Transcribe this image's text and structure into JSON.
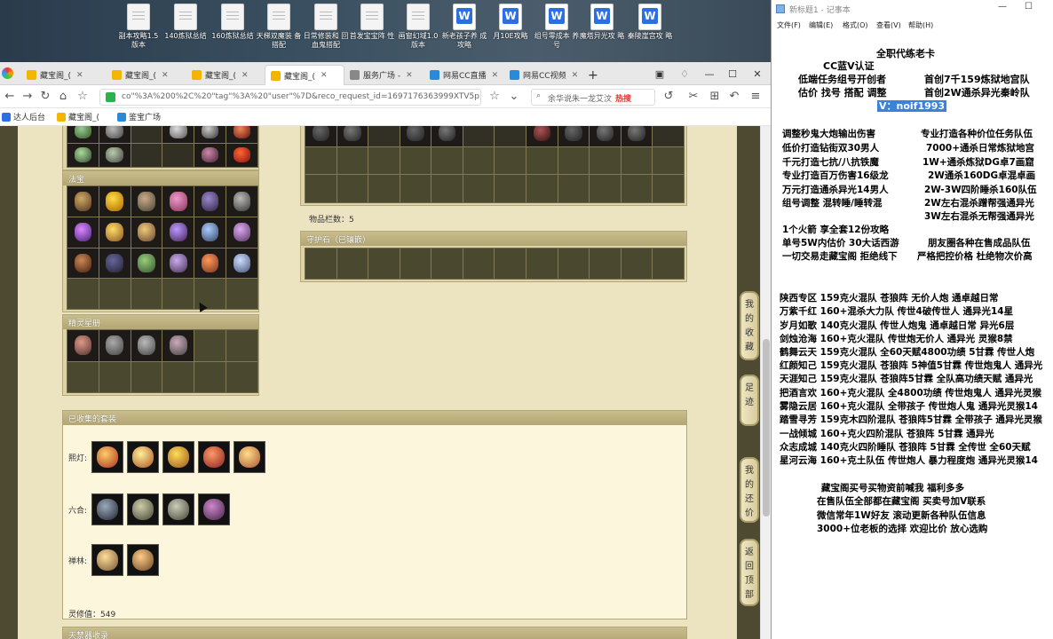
{
  "desktop": {
    "icons": [
      {
        "label": "副本攻略1.5 版本",
        "type": "doc"
      },
      {
        "label": "140炼狱总结",
        "type": "doc"
      },
      {
        "label": "160炼狱总结",
        "type": "doc"
      },
      {
        "label": "天梯双魔装 备搭配",
        "type": "doc"
      },
      {
        "label": "日常修装和 回血鬼搭配",
        "type": "doc"
      },
      {
        "label": "首发宝宝阵 性",
        "type": "doc"
      },
      {
        "label": "画窗幻域1.0 版本",
        "type": "doc"
      },
      {
        "label": "新老孩子养 成攻略",
        "type": "wps"
      },
      {
        "label": "月10E攻略",
        "type": "wps"
      },
      {
        "label": "组号零成本 养号",
        "type": "wps"
      },
      {
        "label": "魔塔异光攻 略",
        "type": "wps"
      },
      {
        "label": "秦陵崖宫攻 略",
        "type": "wps"
      }
    ]
  },
  "browser": {
    "tabs": [
      {
        "label": "藏宝阁_(",
        "color": "#f2b600",
        "active": false
      },
      {
        "label": "藏宝阁_(",
        "color": "#f2b600",
        "active": false
      },
      {
        "label": "藏宝阁_(",
        "color": "#f2b600",
        "active": false
      },
      {
        "label": "藏宝阁_(",
        "color": "#f2b600",
        "active": true
      },
      {
        "label": "服务广场 -",
        "color": "#888888",
        "active": false
      },
      {
        "label": "网易CC直播",
        "color": "#2a8ad8",
        "active": false
      },
      {
        "label": "网易CC视频",
        "color": "#2a8ad8",
        "active": false
      }
    ],
    "new_tab": "+",
    "url": "co\"%3A%200%2C%20\"tag\"%3A%20\"user\"%7D&reco_request_id=1697176363999XTV5p",
    "search_text": "余华说朱一龙艾汶",
    "search_hot": "热搜",
    "bookmarks": [
      {
        "label": "达人后台",
        "color": "#2b6fe3"
      },
      {
        "label": "藏宝阁_(",
        "color": "#f2b600"
      },
      {
        "label": "鉴宝广场",
        "color": "#2a8ad8"
      }
    ]
  },
  "game": {
    "fabao_title": "法宝",
    "jingling_title": "精灵星册",
    "item_count": "物品栏数：5",
    "guardian_title": "守护石（已镶嵌）",
    "suit_title": "已收集的套装",
    "suit_rows": [
      {
        "label": "熙灯:"
      },
      {
        "label": "六合:"
      },
      {
        "label": "禅林:"
      }
    ],
    "spirit_value": "灵修值：549",
    "bottom_title": "天禁器收录",
    "side_buttons": [
      "我的收藏",
      "足迹",
      "我的还价",
      "返回顶部"
    ]
  },
  "notepad": {
    "title": "新标题1 - 记事本",
    "menu": [
      "文件(F)",
      "编辑(E)",
      "格式(O)",
      "查看(V)",
      "帮助(H)"
    ],
    "header_lines": [
      "全职代练老卡",
      "CC蓝V认证",
      "低端任务组号开创者",
      "首创7千159炼狱地宫队",
      "估价 找号 搭配 调整",
      "首创2W通杀异光秦岭队",
      "V：noif1993"
    ],
    "left_col": [
      "调整秒鬼大炮输出伤害",
      "低价打造钻街双30男人",
      "千元打造七抗/八抗铁魔",
      "专业打造百万伤害16级龙",
      "万元打造通杀异光14男人",
      "组号调整 混转睡/睡转混"
    ],
    "right_col": [
      "专业打造各种价位任务队伍",
      "7000+通杀日常炼狱地宫",
      "1W+通杀炼狱DG卓7画窟",
      "2W通杀160DG卓混卓画",
      "2W-3W四阶睡杀160队伍",
      "2W左右混杀蹭帮强通异光",
      "3W左右混杀无帮强通异光"
    ],
    "mid_lines": [
      "1个火箭 享全套12份攻略",
      "单号5W内估价 30大话西游",
      "朋友圈各种在售成品队伍",
      "一切交易走藏宝阁 拒绝线下",
      "严格把控价格 杜绝物次价高"
    ],
    "team_lines": [
      "陕西专区 159克火混队 苍狼阵 无价人炮 通卓越日常",
      "万紫千红 160+混杀大力队 传世4破传世人 通异光14星",
      "岁月如歌 140克火混队 传世人炮鬼 通卓越日常 异光6层",
      "剑烛沧海 160+克火混队 传世炮无价人 通异光 灵猴8禁",
      "鹤舞云天 159克火混队 全60天赋4800功绩 5甘霖 传世人炮",
      "红颜知己 159克火混队 苍狼阵 5神值5甘霖 传世炮鬼人 通异光",
      "天涯知己 159克火混队 苍狼阵5甘霖 全队高功绩天赋 通异光",
      "把酒言欢 160+克火混队 全4800功绩 传世炮鬼人 通异光灵猴",
      "雾隐云居 160+克火混队 全带孩子 传世炮人鬼 通异光灵猴14",
      "踏雪寻芳 159克木四阶混队 苍狼阵5甘霖 全带孩子 通异光灵猴",
      "一战倾城 160+克火四阶混队 苍狼阵 5甘霖 通异光",
      "众志成城 140克火四阶睡队 苍狼阵 5甘霖 全传世 全60天赋",
      "星河云海 160+克土队伍 传世炮人 暴力程度炮 通异光灵猴14"
    ],
    "footer_lines": [
      "藏宝阁买号买物资前喊我 福利多多",
      "在售队伍全部都在藏宝阁 买卖号加V联系",
      "微信常年1W好友 滚动更新各种队伍信息",
      "3000+位老板的选择 欢迎比价 放心选购"
    ]
  }
}
